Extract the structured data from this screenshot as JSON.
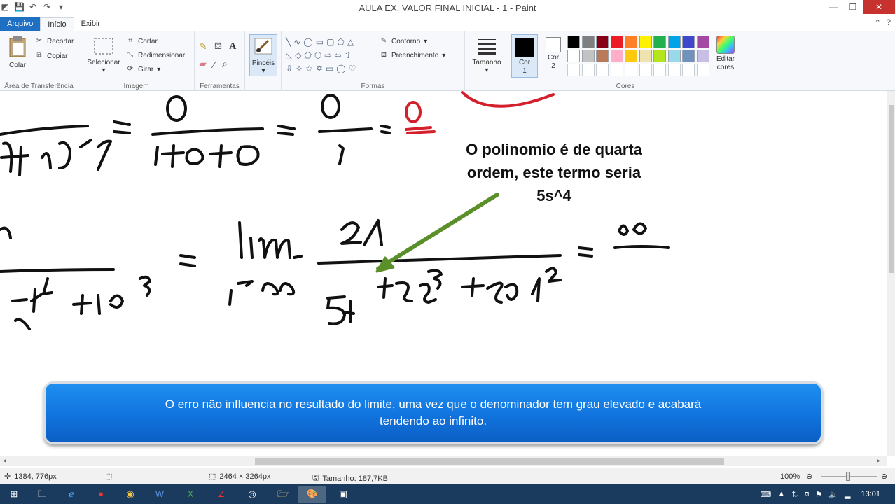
{
  "window": {
    "title": "AULA EX. VALOR FINAL INICIAL - 1 - Paint"
  },
  "tabs": [
    "Arquivo",
    "Início",
    "Exibir"
  ],
  "ribbon": {
    "clipboard": {
      "group": "Área de Transferência",
      "paste": "Colar",
      "cut": "Recortar",
      "copy": "Copiar"
    },
    "image": {
      "group": "Imagem",
      "select": "Selecionar",
      "crop": "Cortar",
      "resize": "Redimensionar",
      "rotate": "Girar"
    },
    "tools": {
      "group": "Ferramentas"
    },
    "brushes": {
      "label": "Pincéis"
    },
    "shapes": {
      "group": "Formas",
      "outline": "Contorno",
      "fill": "Preenchimento"
    },
    "size": {
      "label": "Tamanho"
    },
    "colors": {
      "group": "Cores",
      "color1": "Cor 1",
      "color2": "Cor 2",
      "edit": "Editar cores",
      "row1": [
        "#000000",
        "#7f7f7f",
        "#880015",
        "#ed1c24",
        "#ff7f27",
        "#fff200",
        "#22b14c",
        "#00a2e8",
        "#3f48cc",
        "#a349a4"
      ],
      "row2": [
        "#ffffff",
        "#c3c3c3",
        "#b97a57",
        "#ffaec9",
        "#ffc90e",
        "#efe4b0",
        "#b5e61d",
        "#99d9ea",
        "#7092be",
        "#c8bfe7"
      ]
    }
  },
  "canvas": {
    "annotation": [
      "O polinomio é de quarta",
      "ordem, este termo seria",
      "5s^4"
    ],
    "banner": [
      "O erro não influencia no resultado do limite, uma vez que o denominador tem grau elevado e acabará",
      "tendendo ao infinito."
    ]
  },
  "status": {
    "cursor": "1384, 776px",
    "dimensions": "2464 × 3264px",
    "size": "Tamanho: 187,7KB",
    "zoom": "100%"
  },
  "taskbar": {
    "clock": "13:01"
  }
}
